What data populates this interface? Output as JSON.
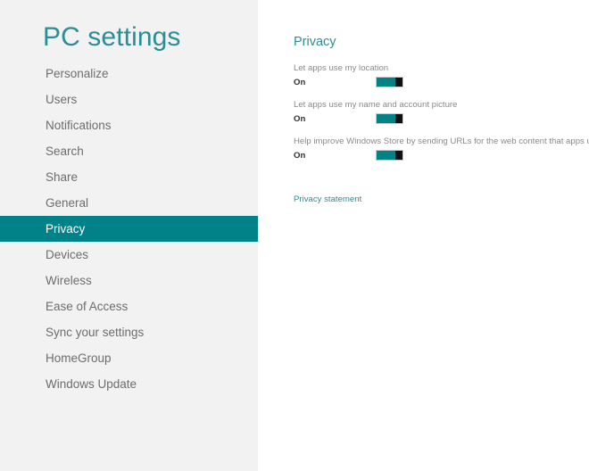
{
  "app": {
    "title": "PC settings",
    "accent_color": "#008288",
    "title_color": "#2b8d95",
    "sidebar_bg": "#f2f2f2",
    "content_bg": "#ffffff"
  },
  "sidebar": {
    "items": [
      {
        "label": "Personalize",
        "selected": false
      },
      {
        "label": "Users",
        "selected": false
      },
      {
        "label": "Notifications",
        "selected": false
      },
      {
        "label": "Search",
        "selected": false
      },
      {
        "label": "Share",
        "selected": false
      },
      {
        "label": "General",
        "selected": false
      },
      {
        "label": "Privacy",
        "selected": true
      },
      {
        "label": "Devices",
        "selected": false
      },
      {
        "label": "Wireless",
        "selected": false
      },
      {
        "label": "Ease of Access",
        "selected": false
      },
      {
        "label": "Sync your settings",
        "selected": false
      },
      {
        "label": "HomeGroup",
        "selected": false
      },
      {
        "label": "Windows Update",
        "selected": false
      }
    ]
  },
  "main": {
    "heading": "Privacy",
    "settings": [
      {
        "label": "Let apps use my location",
        "state": "On",
        "toggle_on": true
      },
      {
        "label": "Let apps use my name and account picture",
        "state": "On",
        "toggle_on": true
      },
      {
        "label": "Help improve Windows Store by sending URLs for the web content that apps use",
        "state": "On",
        "toggle_on": true
      }
    ],
    "privacy_link": "Privacy statement"
  }
}
